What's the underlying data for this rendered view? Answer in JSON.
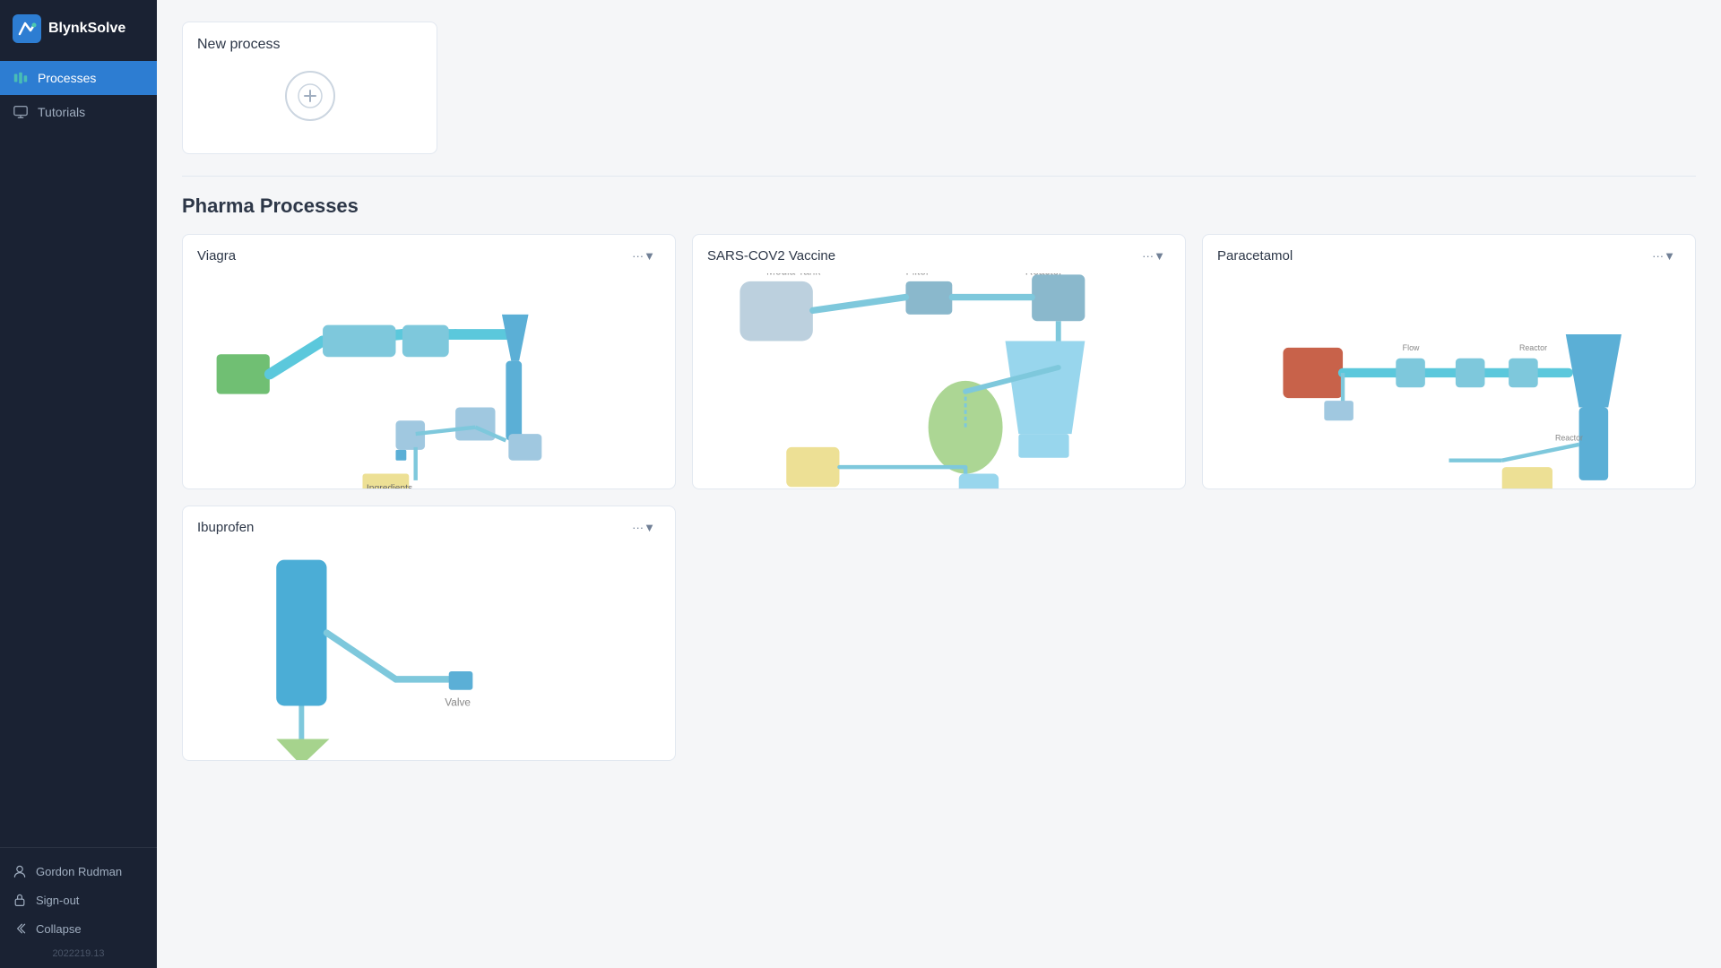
{
  "app": {
    "name": "BlynkSolve",
    "version": "2022219.13"
  },
  "sidebar": {
    "items": [
      {
        "id": "processes",
        "label": "Processes",
        "active": true
      },
      {
        "id": "tutorials",
        "label": "Tutorials",
        "active": false
      }
    ],
    "bottom": [
      {
        "id": "user",
        "label": "Gordon Rudman"
      },
      {
        "id": "signout",
        "label": "Sign-out"
      },
      {
        "id": "collapse",
        "label": "Collapse"
      }
    ]
  },
  "new_process": {
    "title": "New process",
    "add_label": "+"
  },
  "pharma": {
    "section_title": "Pharma Processes",
    "processes": [
      {
        "id": "viagra",
        "name": "Viagra"
      },
      {
        "id": "sars",
        "name": "SARS-COV2 Vaccine"
      },
      {
        "id": "paracetamol",
        "name": "Paracetamol"
      },
      {
        "id": "ibuprofen",
        "name": "Ibuprofen"
      }
    ],
    "more_menu_label": "···▼"
  }
}
